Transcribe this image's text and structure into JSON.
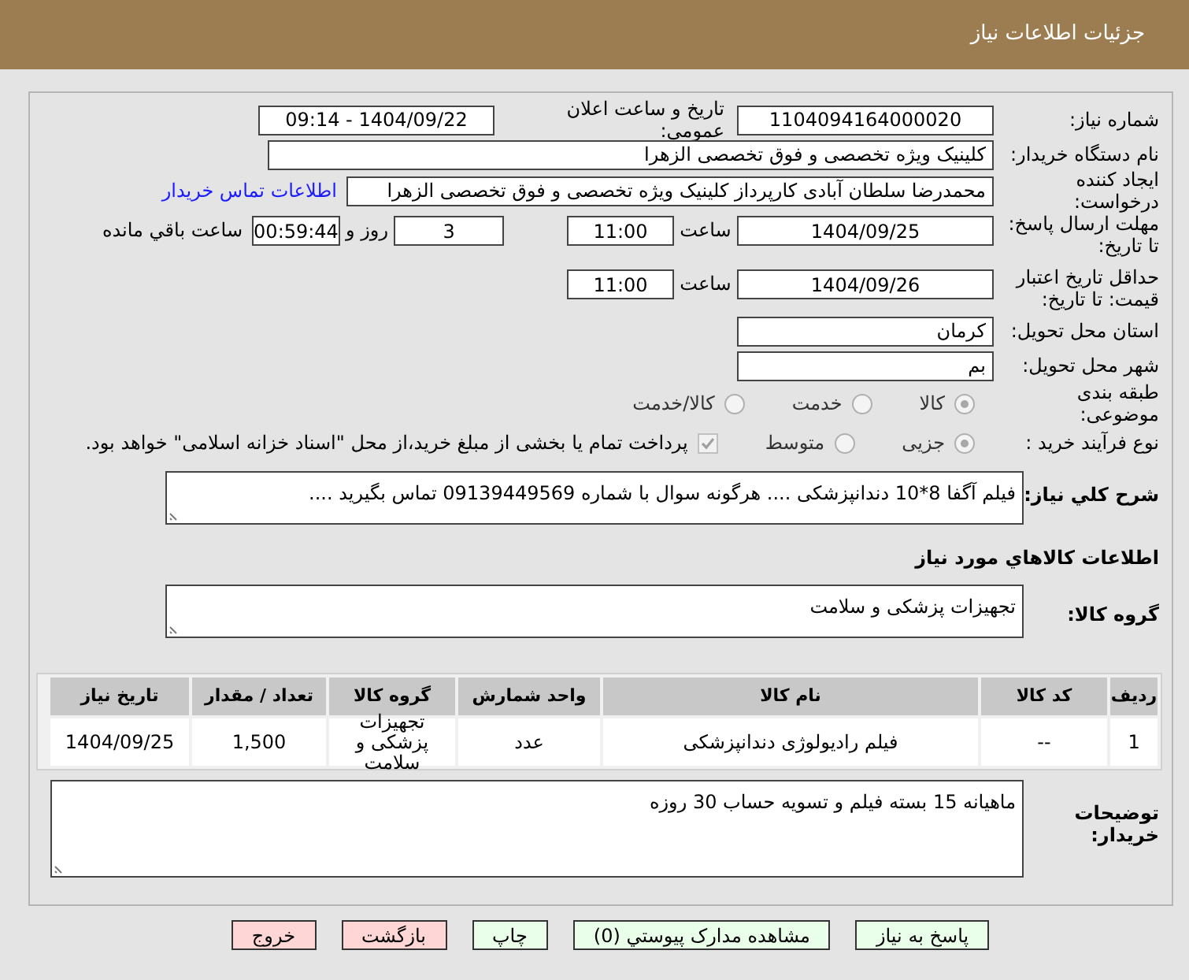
{
  "header": {
    "title": "جزئیات اطلاعات نیاز"
  },
  "need_number": {
    "label": "شماره نیاز:",
    "value": "1104094164000020"
  },
  "announce": {
    "label": "تاریخ و ساعت اعلان عمومی:",
    "value": "1404/09/22 - 09:14"
  },
  "buyer": {
    "label": "نام دستگاه خریدار:",
    "value": "کلینیک ویژه تخصصی و فوق تخصصی الزهرا"
  },
  "requester": {
    "label": "ایجاد کننده درخواست:",
    "value": "محمدرضا سلطان آبادی کارپرداز کلینیک ویژه تخصصی و فوق تخصصی الزهرا",
    "link": "اطلاعات تماس خریدار"
  },
  "deadline": {
    "label": "مهلت ارسال پاسخ: تا تاریخ:",
    "date": "1404/09/25",
    "time_label": "ساعت",
    "time": "11:00",
    "days": "3",
    "days_label": "روز و",
    "remaining": "00:59:44",
    "remaining_label": "ساعت باقي مانده"
  },
  "validity": {
    "label": "حداقل تاریخ اعتبار قیمت: تا تاریخ:",
    "date": "1404/09/26",
    "time_label": "ساعت",
    "time": "11:00"
  },
  "province": {
    "label": "استان محل تحویل:",
    "value": "کرمان"
  },
  "city": {
    "label": "شهر محل تحویل:",
    "value": "بم"
  },
  "category": {
    "label": "طبقه بندی موضوعی:",
    "options": [
      {
        "label": "کالا",
        "selected": true
      },
      {
        "label": "خدمت",
        "selected": false
      },
      {
        "label": "کالا/خدمت",
        "selected": false
      }
    ]
  },
  "process": {
    "label": "نوع فرآیند خرید :",
    "options": [
      {
        "label": "جزیی",
        "selected": true
      },
      {
        "label": "متوسط",
        "selected": false
      }
    ],
    "payment": {
      "checked": true,
      "text": "پرداخت تمام یا بخشی از مبلغ خرید،از محل \"اسناد خزانه اسلامی\" خواهد بود."
    }
  },
  "description": {
    "label": "شرح کلي نیاز:",
    "value": "فیلم آگفا 8*10 دندانپزشکی  .... هرگونه سوال با شماره 09139449569 تماس بگیرید ...."
  },
  "items_heading": "اطلاعات کالاهاي مورد نیاز",
  "goods_group": {
    "label": "گروه کالا:",
    "value": "تجهیزات پزشکی و سلامت"
  },
  "table": {
    "columns": [
      "ردیف",
      "کد کالا",
      "نام کالا",
      "واحد شمارش",
      "گروه کالا",
      "تعداد / مقدار",
      "تاریخ نیاز"
    ],
    "rows": [
      [
        "1",
        "--",
        "فیلم رادیولوژی دندانپزشکی",
        "عدد",
        "تجهیزات پزشکی و سلامت",
        "1,500",
        "1404/09/25"
      ]
    ]
  },
  "notes": {
    "label": "توضیحات خریدار:",
    "value": "ماهیانه 15 بسته فیلم و تسویه حساب  30 روزه"
  },
  "buttons": [
    {
      "label": "پاسخ به نیاز",
      "kind": "action"
    },
    {
      "label": "مشاهده مدارک پیوستي (0)",
      "kind": "action"
    },
    {
      "label": "چاپ",
      "kind": "action"
    },
    {
      "label": "بازگشت",
      "kind": "exit"
    },
    {
      "label": "خروج",
      "kind": "exit"
    }
  ]
}
